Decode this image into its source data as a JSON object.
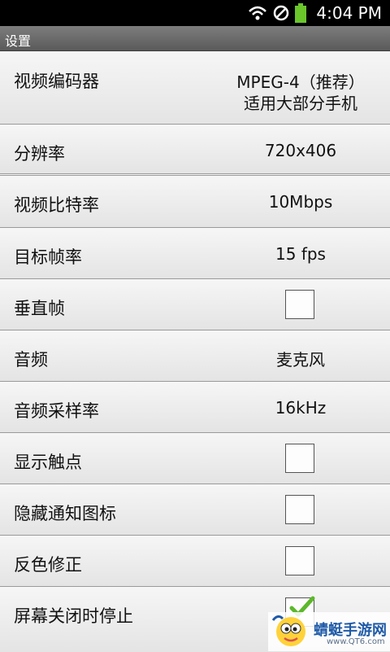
{
  "status_bar": {
    "time": "4:04 PM",
    "icons": [
      "wifi-icon",
      "no-sim-icon",
      "battery-icon"
    ],
    "battery_color": "#6ac62b"
  },
  "title": "设置",
  "settings": [
    {
      "label": "视频编码器",
      "value": "MPEG-4（推荐）",
      "value2": "适用大部分手机"
    },
    {
      "label": "分辨率",
      "value": "720x406"
    },
    {
      "label": "视频比特率",
      "value": "10Mbps"
    },
    {
      "label": "目标帧率",
      "value": "15 fps"
    },
    {
      "label": "垂直帧",
      "checked": false
    },
    {
      "label": "音频",
      "value": "麦克风"
    },
    {
      "label": "音频采样率",
      "value": "16kHz"
    },
    {
      "label": "显示触点",
      "checked": false
    },
    {
      "label": "隐藏通知图标",
      "checked": false
    },
    {
      "label": "反色修正",
      "checked": false
    },
    {
      "label": "屏幕关闭时停止",
      "checked": true
    }
  ],
  "watermark": {
    "name": "蜻蜓手游网",
    "site": "www.QT6.com"
  },
  "colors": {
    "check_accent": "#5cb82a",
    "title_bg": "#6b6b6b"
  }
}
